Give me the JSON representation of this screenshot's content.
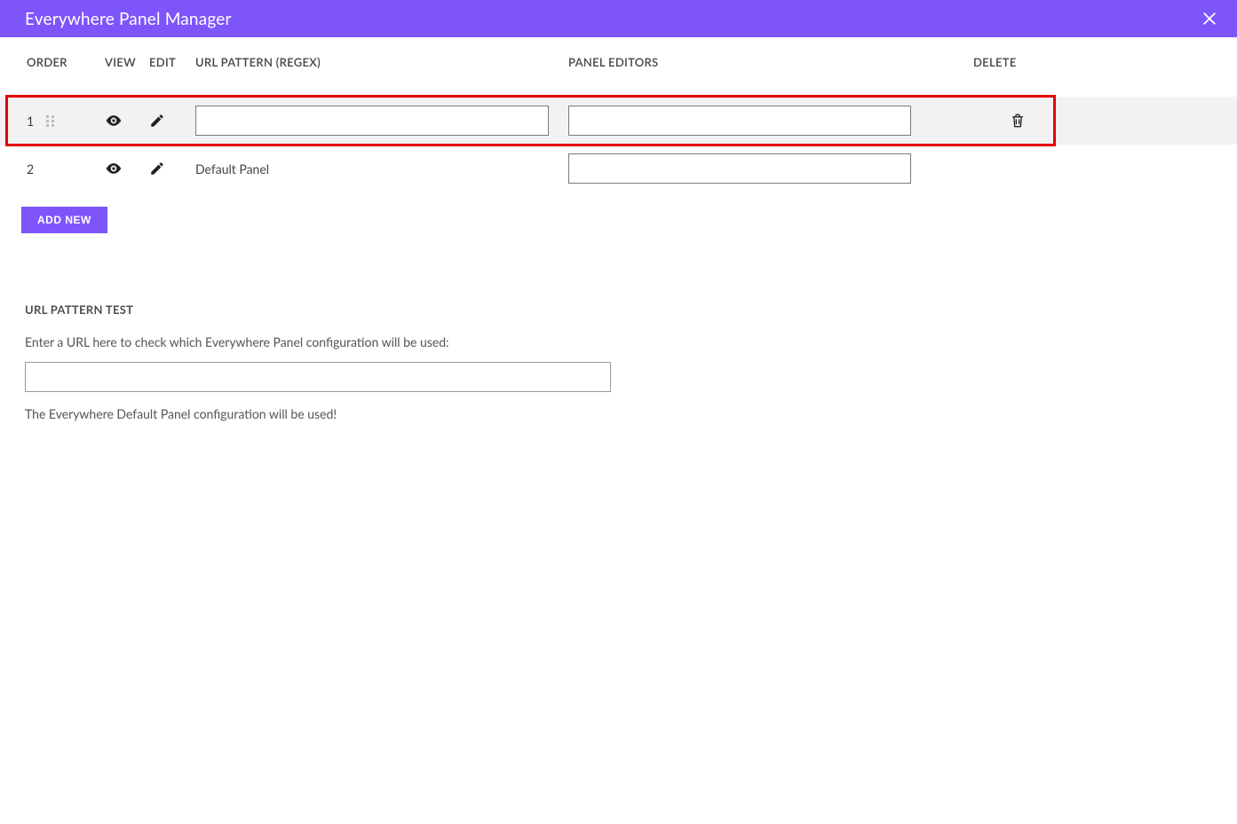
{
  "header": {
    "title": "Everywhere Panel Manager"
  },
  "columns": {
    "order": "ORDER",
    "view": "VIEW",
    "edit": "EDIT",
    "url": "URL PATTERN (REGEX)",
    "editors": "PANEL EDITORS",
    "delete": "DELETE"
  },
  "rows": [
    {
      "order": "1",
      "url_pattern": "",
      "panel_editors": "",
      "draggable": true,
      "deletable": true,
      "highlight": true,
      "url_input": true
    },
    {
      "order": "2",
      "url_pattern": "Default Panel",
      "panel_editors": "",
      "draggable": false,
      "deletable": false,
      "highlight": false,
      "url_input": false
    }
  ],
  "buttons": {
    "add_new": "ADD NEW"
  },
  "test": {
    "title": "URL PATTERN TEST",
    "description": "Enter a URL here to check which Everywhere Panel configuration will be used:",
    "value": "",
    "result": "The Everywhere Default Panel configuration will be used!"
  }
}
